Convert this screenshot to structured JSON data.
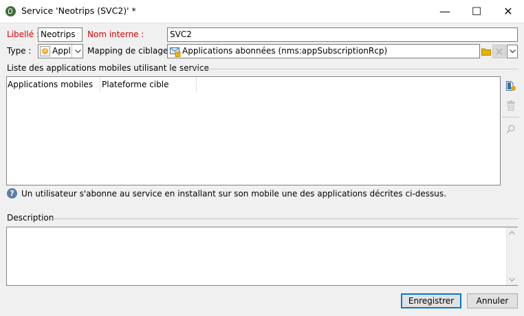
{
  "window": {
    "title": "Service 'Neotrips (SVC2)' *",
    "minimize_glyph": "—",
    "maximize_glyph": "☐",
    "close_glyph": "✕"
  },
  "form": {
    "libelle_label": "Libellé :",
    "libelle_value": "Neotrips",
    "nom_interne_label": "Nom interne :",
    "nom_interne_value": "SVC2",
    "type_label": "Type :",
    "type_value": "Appl",
    "mapping_label": "Mapping de ciblage :",
    "mapping_value": "Applications abonnées (nms:appSubscriptionRcp)"
  },
  "apps_section": {
    "title": "Liste des applications mobiles utilisant le service",
    "columns": [
      "Applications mobiles",
      "Plateforme cible"
    ],
    "rows": []
  },
  "info": {
    "text": "Un utilisateur s'abonne au service en installant sur son mobile une des applications décrites ci-dessus."
  },
  "description": {
    "label": "Description",
    "value": ""
  },
  "buttons": {
    "save": "Enregistrer",
    "cancel": "Annuler"
  },
  "colors": {
    "required_label": "#dd0000",
    "accent": "#0078d7",
    "folder": "#e8b000",
    "info_icon": "#5b7fa8"
  }
}
